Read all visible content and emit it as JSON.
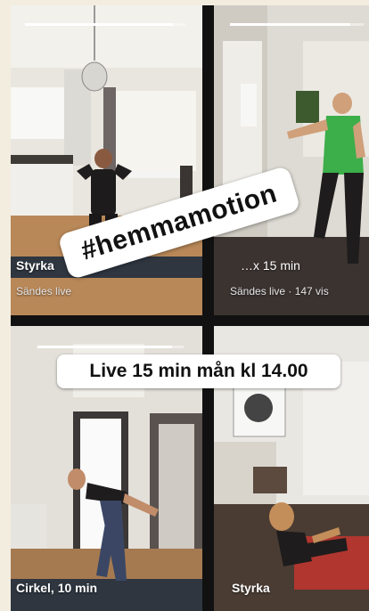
{
  "stickers": {
    "hashtag": "#hemmamotion",
    "live": "Live 15 min mån kl 14.00"
  },
  "tiles": [
    {
      "label": "Styrka",
      "subtitle": "Sändes live",
      "progress": 0.92
    },
    {
      "label": "…x 15 min",
      "subtitle": "Sändes live · 147 vis",
      "progress": 0.9
    },
    {
      "label": "Cirkel, 10 min",
      "progress": 0.92
    },
    {
      "label": "Styrka"
    }
  ]
}
